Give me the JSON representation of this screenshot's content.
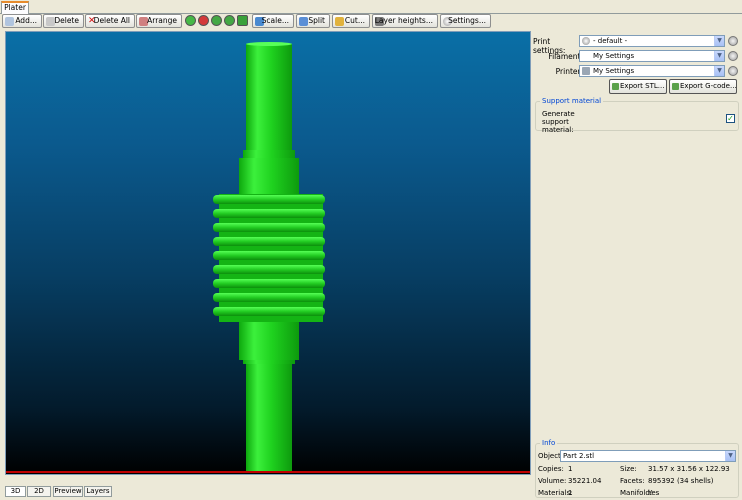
{
  "tabs": [
    {
      "label": "Plater"
    }
  ],
  "toolbar": {
    "add": "Add...",
    "delete": "Delete",
    "delete_all": "Delete All",
    "arrange": "Arrange",
    "scale": "Scale...",
    "split": "Split",
    "cut": "Cut...",
    "layer_heights": "Layer heights...",
    "settings": "Settings..."
  },
  "settings": {
    "print_label": "Print settings:",
    "print_value": "- default -",
    "filament_label": "Filament:",
    "filament_value": "My Settings",
    "printer_label": "Printer:",
    "printer_value": "My Settings"
  },
  "export": {
    "stl": "Export STL...",
    "gcode": "Export G-code..."
  },
  "support": {
    "title": "Support material",
    "generate_label": "Generate support material:",
    "generate_checked": true
  },
  "info": {
    "title": "Info",
    "object_label": "Object:",
    "object_value": "Part 2.stl",
    "copies_label": "Copies:",
    "copies_value": "1",
    "size_label": "Size:",
    "size_value": "31.57 x 31.56 x 122.93",
    "volume_label": "Volume:",
    "volume_value": "35221.04",
    "facets_label": "Facets:",
    "facets_value": "895392 (34 shells)",
    "materials_label": "Materials:",
    "materials_value": "1",
    "manifold_label": "Manifold:",
    "manifold_value": "Yes"
  },
  "view_tabs": [
    {
      "label": "3D"
    },
    {
      "label": "2D"
    },
    {
      "label": "Preview"
    },
    {
      "label": "Layers"
    }
  ],
  "colors": {
    "model_green": "#1fd21f",
    "bed_line": "#c00000",
    "viewport_top": "#0a6fa6",
    "viewport_bottom": "#000000",
    "accent_blue": "#0046d5"
  }
}
